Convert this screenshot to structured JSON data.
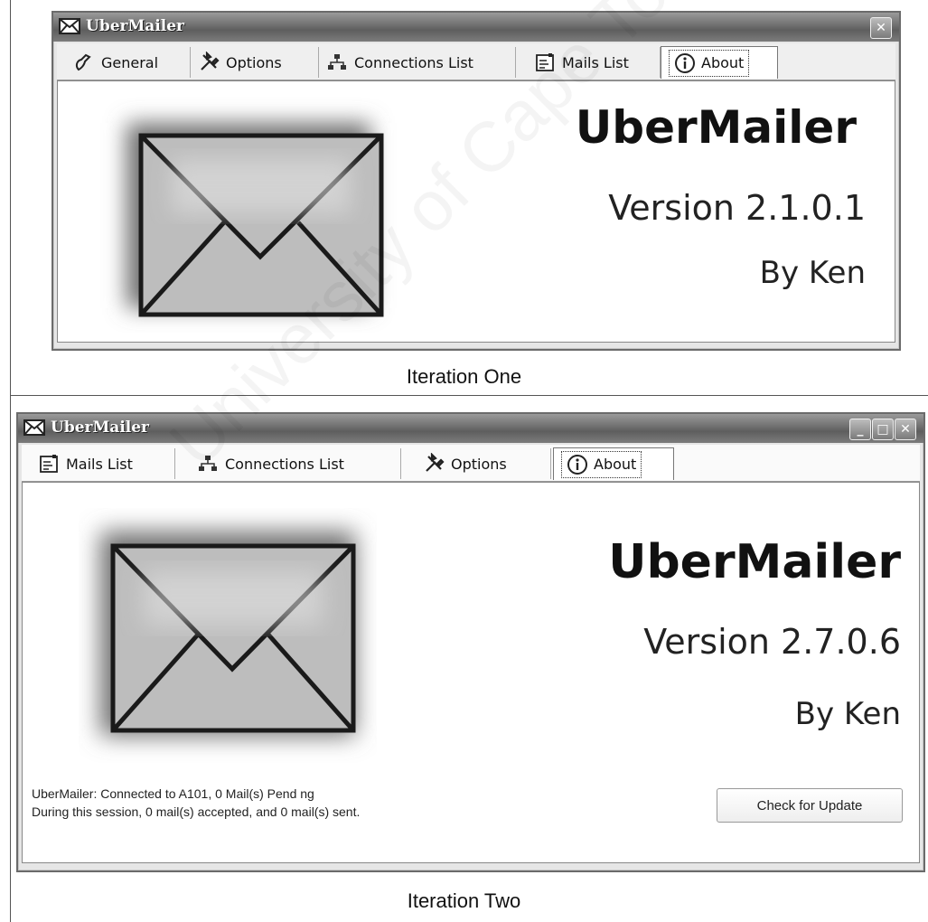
{
  "iteration_one": {
    "window_title": "UberMailer",
    "tabs": [
      {
        "label": "General",
        "icon": "general-icon"
      },
      {
        "label": "Options",
        "icon": "tools-icon"
      },
      {
        "label": "Connections List",
        "icon": "connections-icon"
      },
      {
        "label": "Mails List",
        "icon": "mails-list-icon"
      },
      {
        "label": "About",
        "icon": "info-icon",
        "active": true
      }
    ],
    "app_name": "UberMailer",
    "version": "Version 2.1.0.1",
    "author": "By Ken",
    "caption": "Iteration One"
  },
  "iteration_two": {
    "window_title": "UberMailer",
    "tabs": [
      {
        "label": "Mails List",
        "icon": "mails-list-icon"
      },
      {
        "label": "Connections List",
        "icon": "connections-icon"
      },
      {
        "label": "Options",
        "icon": "tools-icon"
      },
      {
        "label": "About",
        "icon": "info-icon",
        "active": true
      }
    ],
    "app_name": "UberMailer",
    "version": "Version 2.7.0.6",
    "author": "By Ken",
    "status_line_1": "UberMailer: Connected to A101, 0 Mail(s) Pend ng",
    "status_line_2": "During this session, 0 mail(s) accepted, and 0 mail(s) sent.",
    "update_button": "Check for Update",
    "caption": "Iteration Two"
  },
  "watermark": "University of Cape Town",
  "colors": {
    "titlebar": "#6e6e6e",
    "envelope_glow": "#7a7a7a",
    "envelope_face": "#b8b8b8"
  }
}
